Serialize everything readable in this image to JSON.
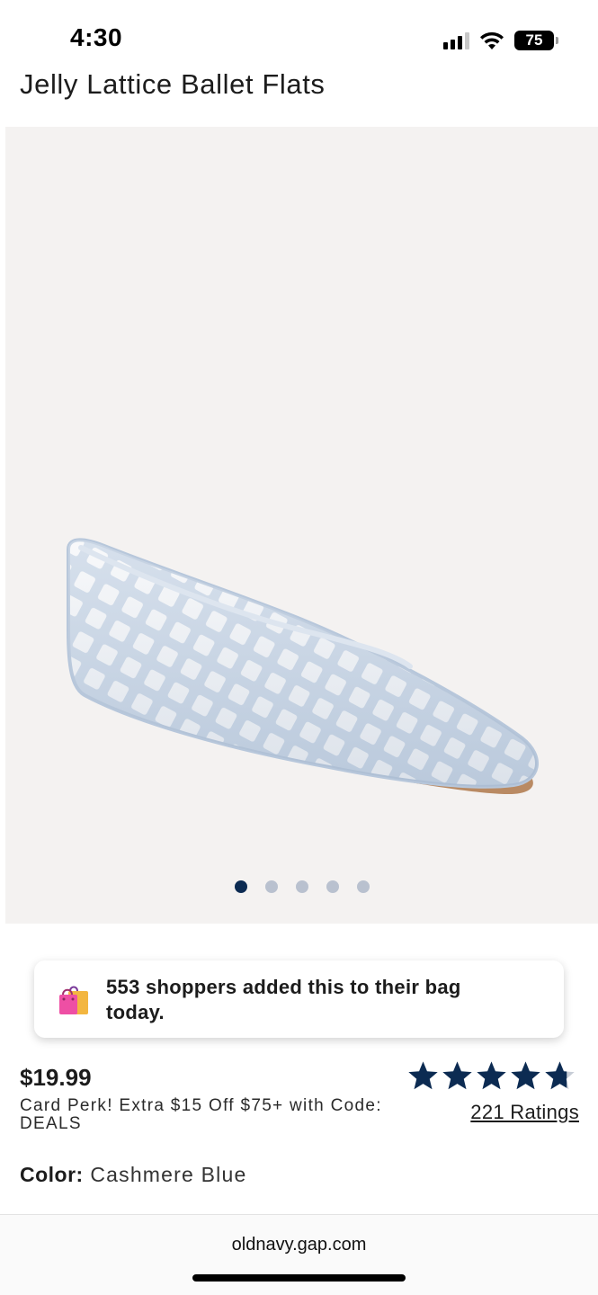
{
  "status_bar": {
    "time": "4:30",
    "battery": "75",
    "icons": [
      "cellular-signal-icon",
      "wifi-icon",
      "battery-icon"
    ]
  },
  "product": {
    "title": "Jelly Lattice Ballet Flats",
    "image_name": "jelly-lattice-ballet-flat-image",
    "gallery": {
      "total_images": 5,
      "active_index": 0
    },
    "price": "$19.99",
    "perk": "Card Perk! Extra $15 Off $75+ with Code: DEALS",
    "rating": {
      "stars": 4.7,
      "max": 5,
      "label": "221 Ratings"
    },
    "color": {
      "label": "Color:",
      "value": "Cashmere Blue"
    }
  },
  "toast": {
    "icon": "shopping-bags-icon",
    "text": "553 shoppers added this to their bag today."
  },
  "browser": {
    "url": "oldnavy.gap.com"
  },
  "colors": {
    "accent_navy": "#0c2b52",
    "image_bg": "#f4f2f1",
    "shoe_blue": "#c9d6e6"
  }
}
